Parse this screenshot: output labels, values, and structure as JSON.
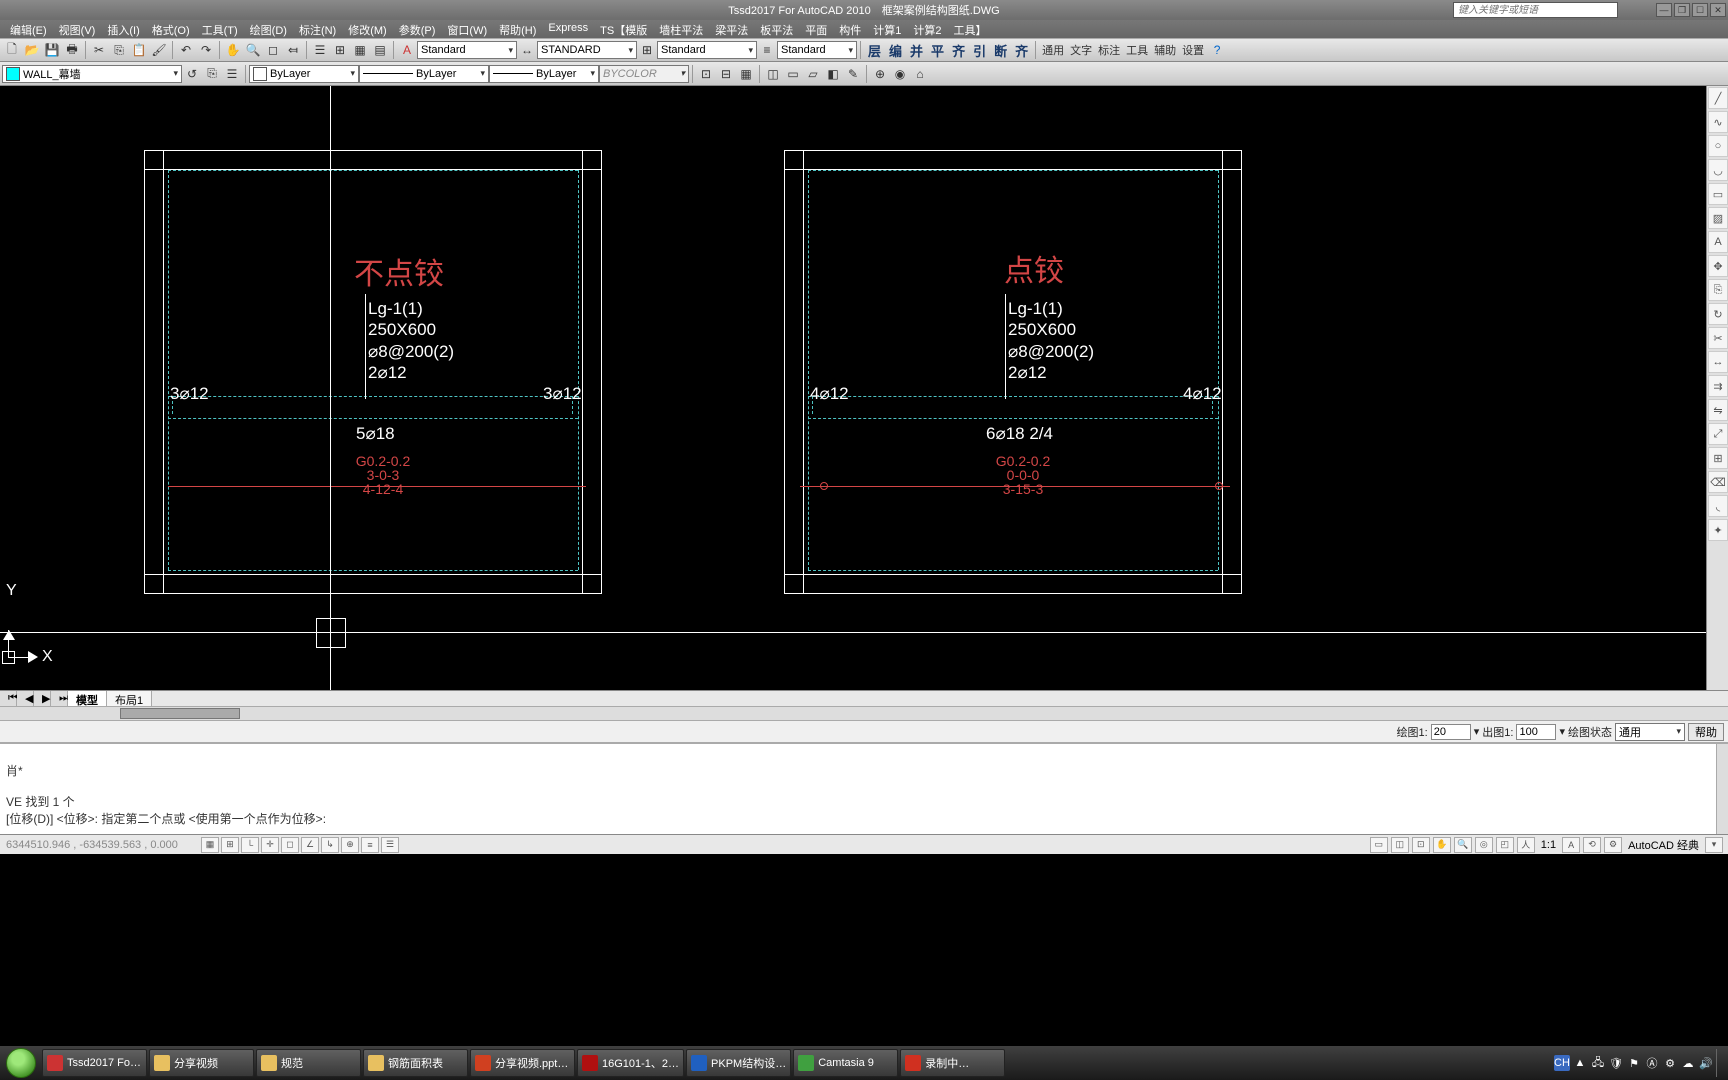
{
  "title": "Tssd2017 For AutoCAD 2010　框架案例结构图纸.DWG",
  "search_placeholder": "键入关键字或短语",
  "menus": [
    "编辑(E)",
    "视图(V)",
    "插入(I)",
    "格式(O)",
    "工具(T)",
    "绘图(D)",
    "标注(N)",
    "修改(M)",
    "参数(P)",
    "窗口(W)",
    "帮助(H)",
    "Express",
    "TS【模版",
    "墙柱平法",
    "梁平法",
    "板平法",
    "平面",
    "构件",
    "计算1",
    "计算2",
    "工具】"
  ],
  "toolbar1": {
    "std1": "Standard",
    "std2": "STANDARD",
    "std3": "Standard",
    "std4": "Standard",
    "right_labels": [
      "层",
      "编",
      "并",
      "平",
      "齐",
      "引",
      "断",
      "齐"
    ],
    "panel_labels": [
      "通用",
      "文字",
      "标注",
      "工具",
      "辅助",
      "设置"
    ]
  },
  "layerrow": {
    "layer": "WALL_幕墙",
    "linetype": "ByLayer",
    "lineweight": "ByLayer",
    "lineweight2": "ByLayer",
    "color_label": "BYCOLOR"
  },
  "drawing": {
    "left": {
      "title": "不点铰",
      "beam_label": "Lg-1(1)\n250X600\n⌀8@200(2)\n2⌀12",
      "top_l": "3⌀12",
      "top_r": "3⌀12",
      "bot": "5⌀18",
      "red1": "G0.2-0.2",
      "red2": "3-0-3",
      "red3": "4-12-4"
    },
    "right": {
      "title": "点铰",
      "beam_label": "Lg-1(1)\n250X600\n⌀8@200(2)\n2⌀12",
      "top_l": "4⌀12",
      "top_r": "4⌀12",
      "bot": "6⌀18 2/4",
      "red1": "G0.2-0.2",
      "red2": "0-0-0",
      "red3": "3-15-3"
    },
    "ucs_x": "X",
    "ucs_y": "Y"
  },
  "tabs": {
    "model": "模型",
    "layout1": "布局1"
  },
  "scale": {
    "draw_lbl": "绘图1:",
    "draw_val": "20",
    "out_lbl": "出图1:",
    "out_val": "100",
    "state_lbl": "绘图状态",
    "state_val": "通用",
    "help": "帮助"
  },
  "cmd": {
    "l1": "肖*",
    "l2": "VE 找到 1 个",
    "l3": "[位移(D)] <位移>:  指定第二个点或 <使用第一个点作为位移>:"
  },
  "status": {
    "coords": "6344510.946 , -634539.563 , 0.000",
    "scale": "1:1",
    "workspace": "AutoCAD 经典"
  },
  "taskbar": {
    "items": [
      "Tssd2017 Fo…",
      "分享视频",
      "规范",
      "钢筋面积表",
      "分享视频.ppt…",
      "16G101-1、2…",
      "PKPM结构设…",
      "Camtasia 9",
      "录制中…"
    ],
    "ime": "CH"
  }
}
